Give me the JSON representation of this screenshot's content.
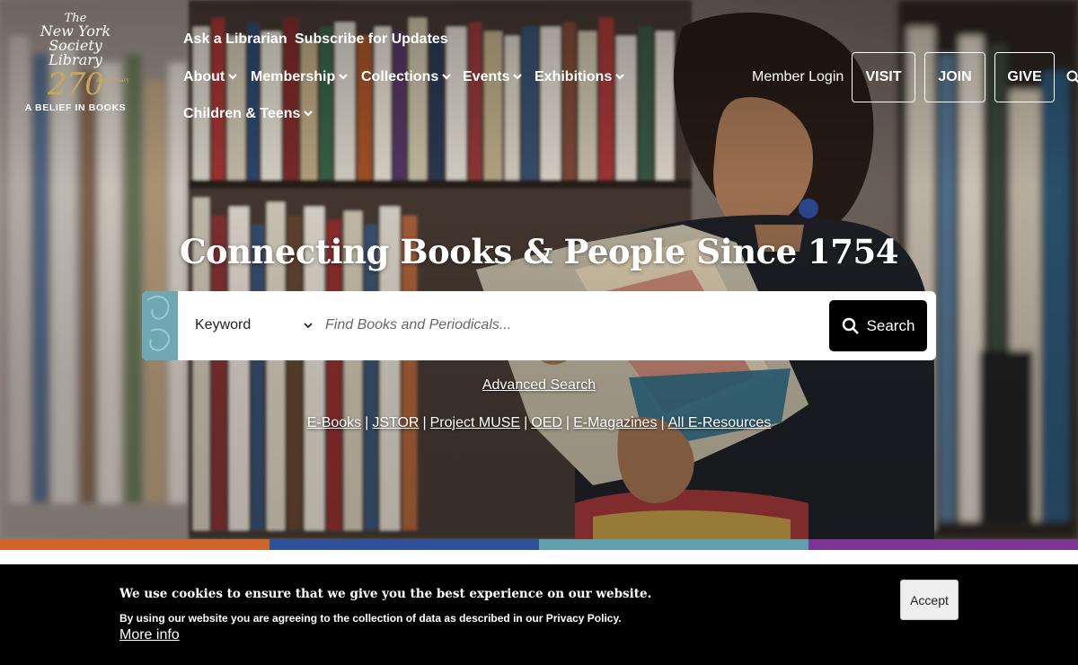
{
  "logo": {
    "the": "The",
    "line1": "New York",
    "line2": "Society",
    "line3": "Library",
    "anniversary": "270",
    "anniversary_small": "Anniversary",
    "tagline": "A BELIEF IN BOOKS"
  },
  "utility_nav": {
    "ask": "Ask a Librarian",
    "subscribe": "Subscribe for Updates"
  },
  "main_nav": {
    "items": [
      {
        "label": "About"
      },
      {
        "label": "Membership"
      },
      {
        "label": "Collections"
      },
      {
        "label": "Events"
      },
      {
        "label": "Exhibitions"
      },
      {
        "label": "Children & Teens"
      }
    ],
    "chevron_icon": "chevron-down-icon"
  },
  "account": {
    "member_login": "Member Login",
    "visit": "VISIT",
    "join": "JOIN",
    "give": "GIVE",
    "search_icon": "search-icon"
  },
  "hero": {
    "headline": "Connecting Books & People Since 1754"
  },
  "search": {
    "scope_selected": "Keyword",
    "placeholder": "Find Books and Periodicals...",
    "button_label": "Search",
    "advanced": "Advanced Search"
  },
  "resources": [
    "E-Books",
    "JSTOR",
    "Project MUSE",
    "OED",
    "E-Magazines",
    "All E-Resources"
  ],
  "resource_separator": "|",
  "stripe_colors": [
    "#d0652c",
    "#2f519a",
    "#5fa0ab",
    "#7b3694"
  ],
  "cookie": {
    "title": "We use cookies to ensure that we give you the best experience on our website.",
    "body": "By using our website you are agreeing to the collection of data as described in our Privacy Policy.",
    "more_info": "More info",
    "accept": "Accept"
  }
}
